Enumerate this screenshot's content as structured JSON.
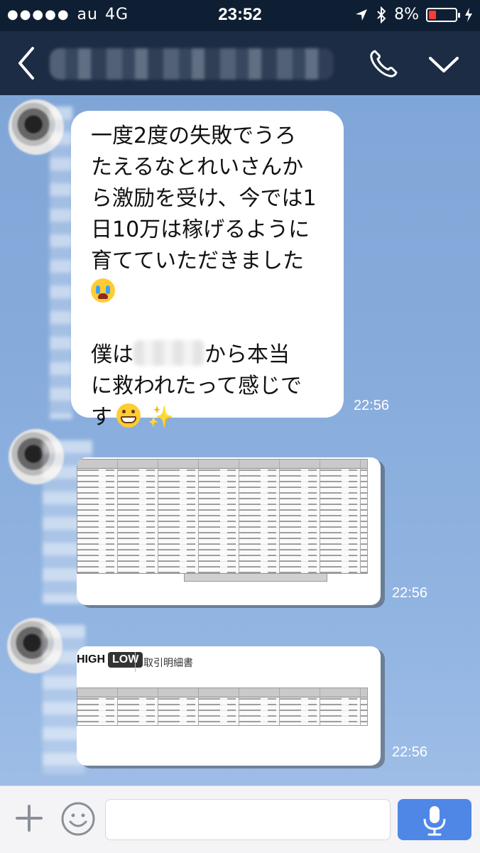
{
  "status_bar": {
    "signal_dots": "●●●●●",
    "carrier": "au",
    "network": "4G",
    "time": "23:52",
    "battery_percent_text": "8%",
    "battery_level": 0.08,
    "battery_color": "#ff3b30"
  },
  "nav": {
    "back_icon": "chevron-left-icon",
    "call_icon": "phone-icon",
    "menu_icon": "chevron-down-icon"
  },
  "messages": [
    {
      "type": "text",
      "lines_part1": "一度2度の失敗でうろ\nたえるなとれいさんか\nら激励を受け、今では1\n日10万は稼げるように\n育てていただきました",
      "emoji1": "loudly-crying-face",
      "line_part2_pre": "僕は",
      "line_part2_post": "から本当\nに救われたって感じで\nす",
      "emoji2": "grinning-face",
      "emoji3": "✨",
      "time": "22:56"
    },
    {
      "type": "image",
      "description": "trade-history-table",
      "time": "22:56"
    },
    {
      "type": "image",
      "logo_part1": "HIGH",
      "logo_part2": "LOW",
      "doc_title": "取引明細書",
      "time": "22:56"
    }
  ],
  "input_bar": {
    "plus_icon": "plus-icon",
    "emoji_icon": "smiley-icon",
    "input_placeholder": "",
    "mic_icon": "microphone-icon",
    "accent_color": "#4f87e6"
  }
}
